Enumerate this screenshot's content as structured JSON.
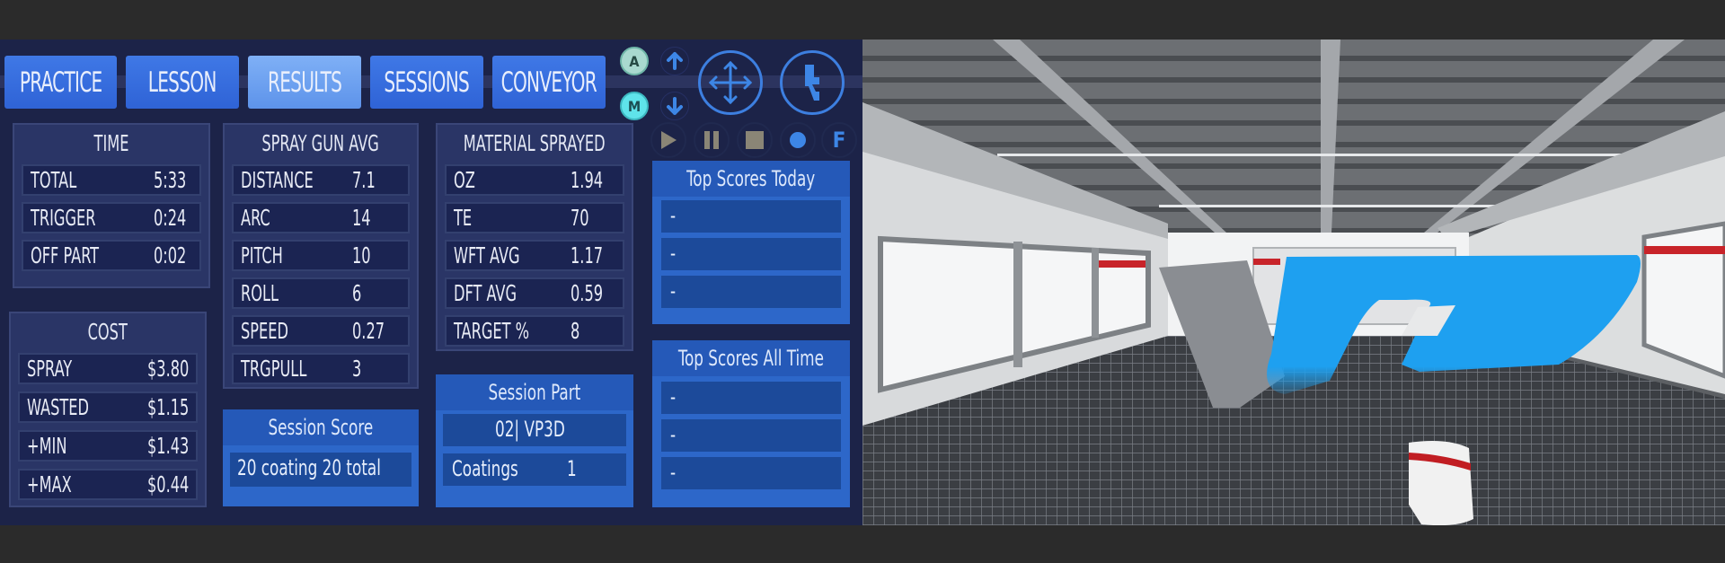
{
  "tabs": [
    {
      "label": "PRACTICE",
      "active": false
    },
    {
      "label": "LESSON",
      "active": false
    },
    {
      "label": "RESULTS",
      "active": true
    },
    {
      "label": "SESSIONS",
      "active": false
    },
    {
      "label": "CONVEYOR",
      "active": false
    }
  ],
  "controls": {
    "auto_label": "A",
    "manual_label": "M",
    "focus_label": "F",
    "icons": [
      "arrow-up-icon",
      "arrow-down-icon",
      "move-icon",
      "spray-gun-icon",
      "play-icon",
      "pause-icon",
      "stop-icon",
      "record-icon"
    ]
  },
  "time": {
    "title": "TIME",
    "rows": [
      {
        "label": "TOTAL",
        "value": "5:33"
      },
      {
        "label": "TRIGGER",
        "value": "0:24"
      },
      {
        "label": "OFF PART",
        "value": "0:02"
      }
    ]
  },
  "cost": {
    "title": "COST",
    "rows": [
      {
        "label": "SPRAY",
        "value": "$3.80"
      },
      {
        "label": "WASTED",
        "value": "$1.15"
      },
      {
        "label": "+MIN",
        "value": "$1.43"
      },
      {
        "label": "+MAX",
        "value": "$0.44"
      }
    ]
  },
  "spray_gun_avg": {
    "title": "SPRAY GUN AVG",
    "rows": [
      {
        "label": "DISTANCE",
        "value": "7.1"
      },
      {
        "label": "ARC",
        "value": "14"
      },
      {
        "label": "PITCH",
        "value": "10"
      },
      {
        "label": "ROLL",
        "value": "6"
      },
      {
        "label": "SPEED",
        "value": "0.27"
      },
      {
        "label": "TRGPULL",
        "value": "3"
      }
    ]
  },
  "material_sprayed": {
    "title": "MATERIAL SPRAYED",
    "rows": [
      {
        "label": "OZ",
        "value": "1.94"
      },
      {
        "label": "TE",
        "value": "70"
      },
      {
        "label": "WFT AVG",
        "value": "1.17"
      },
      {
        "label": "DFT AVG",
        "value": "0.59"
      },
      {
        "label": "TARGET %",
        "value": "8"
      }
    ]
  },
  "session_score": {
    "title": "Session Score",
    "value": "20 coating 20 total"
  },
  "session_part": {
    "title": "Session Part",
    "part": "02| VP3D",
    "coatings_label": "Coatings",
    "coatings_value": "1"
  },
  "top_scores_today": {
    "title": "Top Scores Today",
    "entries": [
      "-",
      "-",
      "-"
    ]
  },
  "top_scores_all_time": {
    "title": "Top Scores All Time",
    "entries": [
      "-",
      "-",
      "-"
    ]
  },
  "scene": {
    "description": "3D paint booth view with partially coated VP logo part and spray gun",
    "coating_color": "#1ea0f0",
    "part_color": "#8a8d92"
  }
}
